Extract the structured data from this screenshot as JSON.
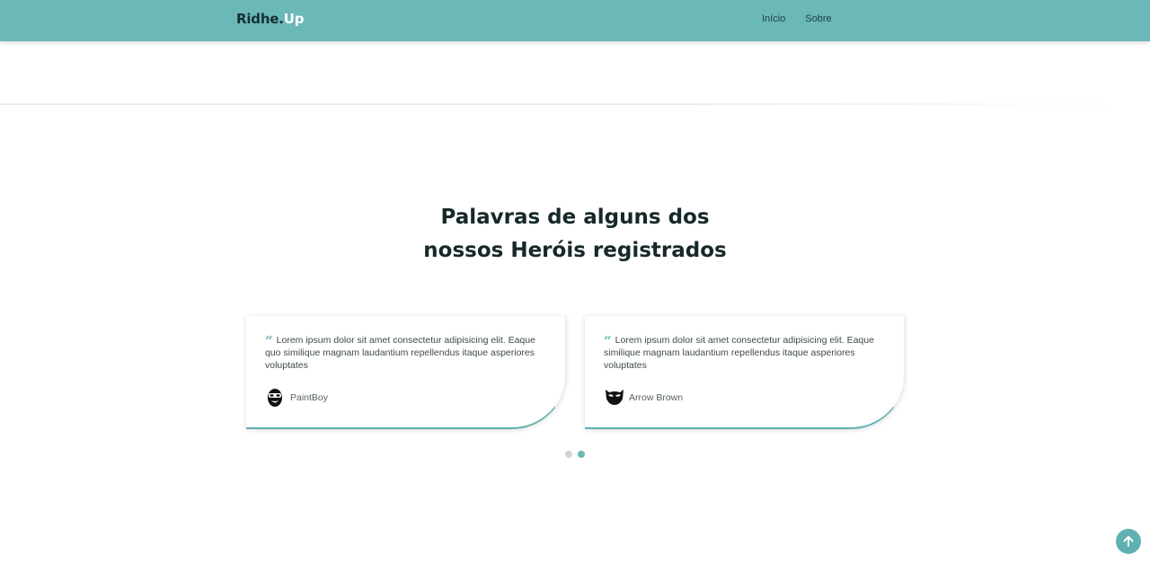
{
  "navbar": {
    "brand_main": "Ridhe.",
    "brand_accent": "Up",
    "links": [
      {
        "label": "Início"
      },
      {
        "label": "Sobre"
      }
    ]
  },
  "section": {
    "title_line1": "Palavras de alguns dos",
    "title_line2": "nossos Heróis registrados"
  },
  "testimonials": [
    {
      "quote": "Lorem ipsum dolor sit amet consectetur adipisicing elit. Eaque quo similique magnam laudantium repellendus itaque asperiores voluptates",
      "author": "PaintBoy",
      "avatar_icon": "hero-mask-paintboy-icon"
    },
    {
      "quote": "Lorem ipsum dolor sit amet consectetur adipisicing elit. Eaque similique magnam laudantium repellendus itaque asperiores voluptates",
      "author": "Arrow Brown",
      "avatar_icon": "hero-mask-arrow-icon"
    }
  ],
  "carousel": {
    "dot_count": 2,
    "active_index": 1
  },
  "colors": {
    "primary": "#6bb8b8",
    "accent_dark": "#5fb0b0",
    "heading": "#16282a"
  },
  "icons": {
    "quote": "quote-icon",
    "back_to_top": "arrow-up-icon"
  }
}
